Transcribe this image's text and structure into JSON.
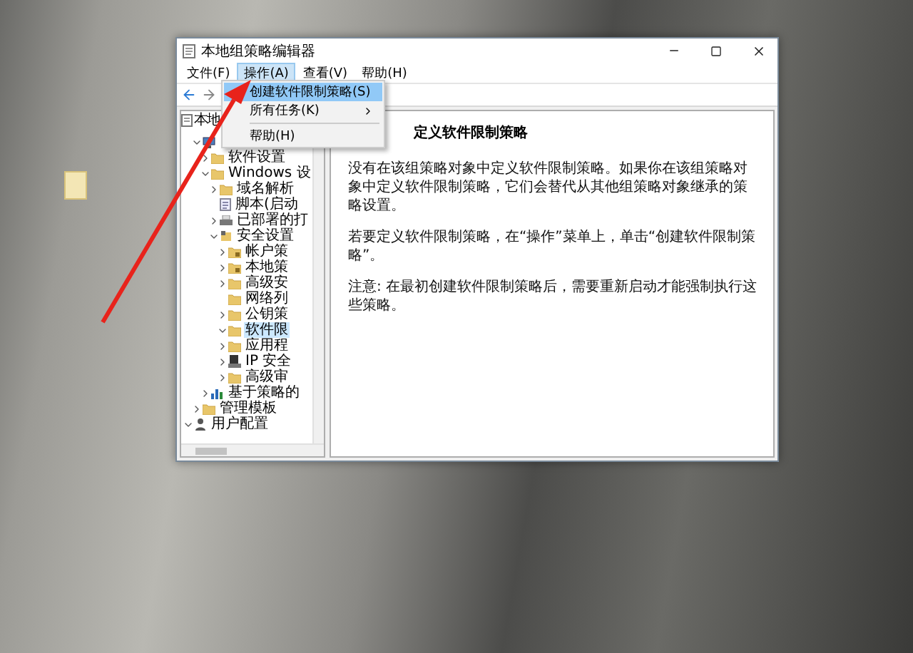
{
  "window": {
    "title": "本地组策略编辑器"
  },
  "menu_bar": [
    {
      "label": "文件(F)",
      "selected": false
    },
    {
      "label": "操作(A)",
      "selected": true
    },
    {
      "label": "查看(V)",
      "selected": false
    },
    {
      "label": "帮助(H)",
      "selected": false
    }
  ],
  "dropdown": [
    {
      "kind": "item",
      "label": "创建软件限制策略(S)",
      "selected": true
    },
    {
      "kind": "submenu",
      "label": "所有任务(K)",
      "selected": false
    },
    {
      "kind": "separator"
    },
    {
      "kind": "item",
      "label": "帮助(H)",
      "selected": false
    }
  ],
  "tree": [
    {
      "kind": "policy",
      "label": "本地",
      "selected": false,
      "children": [
        {
          "kind": "computer",
          "expanded": true,
          "children": [
            {
              "kind": "folder",
              "label": "软件设置",
              "expanded": false,
              "selected": false
            },
            {
              "kind": "folder",
              "label": "Windows 设",
              "expanded": true,
              "selected": false,
              "children": [
                {
                  "kind": "folder",
                  "label": "域名解析",
                  "expanded": false,
                  "selected": false
                },
                {
                  "kind": "script",
                  "label": "脚本(启动",
                  "selected": false
                },
                {
                  "kind": "printer",
                  "label": "已部署的打",
                  "expanded": false,
                  "selected": false
                },
                {
                  "kind": "security",
                  "label": "安全设置",
                  "expanded": true,
                  "selected": false,
                  "children": [
                    {
                      "kind": "lockfolder",
                      "label": "帐户策",
                      "expanded": false,
                      "selected": false
                    },
                    {
                      "kind": "lockfolder",
                      "label": "本地策",
                      "expanded": false,
                      "selected": false
                    },
                    {
                      "kind": "folder",
                      "label": "高级安",
                      "expanded": false,
                      "selected": false
                    },
                    {
                      "kind": "folder",
                      "label": "网络列",
                      "selected": false
                    },
                    {
                      "kind": "folder",
                      "label": "公钥策",
                      "expanded": false,
                      "selected": false
                    },
                    {
                      "kind": "folder",
                      "label": "软件限",
                      "expanded": true,
                      "selected": true
                    },
                    {
                      "kind": "folder",
                      "label": "应用程",
                      "expanded": false,
                      "selected": false
                    },
                    {
                      "kind": "ipsec",
                      "label": "IP 安全",
                      "expanded": false,
                      "selected": false
                    },
                    {
                      "kind": "folder",
                      "label": "高级审",
                      "expanded": false,
                      "selected": false
                    }
                  ]
                }
              ]
            },
            {
              "kind": "chart",
              "label": "基于策略的",
              "expanded": false,
              "selected": false
            }
          ]
        },
        {
          "kind": "folder",
          "label": "管理模板",
          "expanded": false,
          "selected": false
        }
      ]
    },
    {
      "kind": "user",
      "label": "用户配置",
      "expanded": true,
      "selected": false
    }
  ],
  "detail": {
    "heading": "定义软件限制策略",
    "paragraphs": [
      "没有在该组策略对象中定义软件限制策略。如果你在该组策略对象中定义软件限制策略，它们会替代从其他组策略对象继承的策略设置。",
      "若要定义软件限制策略，在“操作”菜单上，单击“创建软件限制策略”。",
      "注意: 在最初创建软件限制策略后，需要重新启动才能强制执行这些策略。"
    ]
  }
}
